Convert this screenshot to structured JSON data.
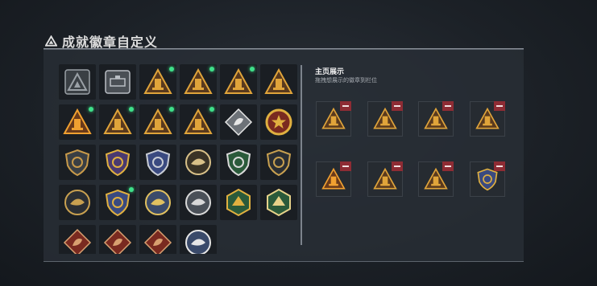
{
  "header": {
    "title": "成就徽章自定义",
    "icon": "triangle-logo-icon"
  },
  "collection": {
    "badges": [
      {
        "shape": "triangle-frame",
        "icon": "triangle-plain-badge-icon",
        "fill": "#3a3f44",
        "accent": "#9aa0a6",
        "new": false
      },
      {
        "shape": "shield-frame",
        "icon": "tank-badge-icon",
        "fill": "#4a4f55",
        "accent": "#b9bec4",
        "new": false
      },
      {
        "shape": "triangle",
        "icon": "triangle-skyscraper-badge-icon",
        "fill": "#5a3a1e",
        "accent": "#e0a43a",
        "new": true
      },
      {
        "shape": "triangle",
        "icon": "triangle-building-badge-icon",
        "fill": "#5a3a1e",
        "accent": "#e0a43a",
        "new": true
      },
      {
        "shape": "triangle",
        "icon": "triangle-tower-badge-icon",
        "fill": "#5a3a1e",
        "accent": "#e0a43a",
        "new": true
      },
      {
        "shape": "triangle",
        "icon": "triangle-warship-badge-icon",
        "fill": "#5a3a1e",
        "accent": "#e0a43a",
        "new": false
      },
      {
        "shape": "triangle",
        "icon": "triangle-number-one-badge-icon",
        "fill": "#6a3a1a",
        "accent": "#f0a030",
        "new": true
      },
      {
        "shape": "triangle",
        "icon": "triangle-house-badge-icon",
        "fill": "#5a3a1e",
        "accent": "#e0a43a",
        "new": true
      },
      {
        "shape": "triangle",
        "icon": "triangle-soldiers-badge-icon",
        "fill": "#5a3a1e",
        "accent": "#e0a43a",
        "new": true
      },
      {
        "shape": "triangle",
        "icon": "triangle-rocket-badge-icon",
        "fill": "#5a3a1e",
        "accent": "#e0a43a",
        "new": true
      },
      {
        "shape": "diamond",
        "icon": "silver-diamond-badge-icon",
        "fill": "#6d7278",
        "accent": "#e6e6e6",
        "new": false
      },
      {
        "shape": "round-medal",
        "icon": "star-wreath-medal-icon",
        "fill": "#7a2a20",
        "accent": "#e0b040",
        "new": false
      },
      {
        "shape": "shield",
        "icon": "rank-shield-badge-icon",
        "fill": "#3a3f44",
        "accent": "#c89a4a",
        "new": false
      },
      {
        "shape": "shield",
        "icon": "purple-eagle-shield-icon",
        "fill": "#4a3a70",
        "accent": "#e0b040",
        "new": false
      },
      {
        "shape": "shield",
        "icon": "blue-eagle-shield-icon",
        "fill": "#3a4a80",
        "accent": "#c8ccd4",
        "new": false
      },
      {
        "shape": "circle",
        "icon": "skull-target-badge-icon",
        "fill": "#3a3326",
        "accent": "#d8c088",
        "new": false
      },
      {
        "shape": "shield",
        "icon": "green-snake-shield-icon",
        "fill": "#2a5a3a",
        "accent": "#d8d8d8",
        "new": false
      },
      {
        "shape": "shield",
        "icon": "dark-rifle-shield-icon",
        "fill": "#2a2e33",
        "accent": "#c8a050",
        "new": false
      },
      {
        "shape": "circle",
        "icon": "crossed-circle-badge-icon",
        "fill": "#2a2e33",
        "accent": "#c8a050",
        "new": false
      },
      {
        "shape": "shield",
        "icon": "star-eagle-shield-icon",
        "fill": "#3a4a80",
        "accent": "#e0b040",
        "new": true
      },
      {
        "shape": "circle",
        "icon": "blue-bird-circle-icon",
        "fill": "#3a4a6a",
        "accent": "#e0c060",
        "new": false
      },
      {
        "shape": "circle",
        "icon": "steel-bird-circle-icon",
        "fill": "#4a5058",
        "accent": "#d8d8d8",
        "new": false
      },
      {
        "shape": "hexagon",
        "icon": "green-dragon-hex-icon",
        "fill": "#2a5a3a",
        "accent": "#e0b040",
        "new": false
      },
      {
        "shape": "hexagon",
        "icon": "green-eagle-hex-icon",
        "fill": "#2a5a3a",
        "accent": "#e6d28a",
        "new": false
      },
      {
        "shape": "diamond",
        "icon": "red-wolf-diamond-icon",
        "fill": "#7a2a20",
        "accent": "#d8a070",
        "new": false
      },
      {
        "shape": "diamond",
        "icon": "red-beast-diamond-icon",
        "fill": "#7a2a20",
        "accent": "#d8a070",
        "new": false
      },
      {
        "shape": "diamond",
        "icon": "red-soldier-diamond-icon",
        "fill": "#7a2a20",
        "accent": "#d8a070",
        "new": false
      },
      {
        "shape": "circle",
        "icon": "blue-ship-circle-icon",
        "fill": "#3a4a6a",
        "accent": "#e6e6e6",
        "new": false
      }
    ]
  },
  "showcase": {
    "title": "主页展示",
    "subtitle": "拖拽想展示的徽章到栏位",
    "slots": [
      {
        "icon": "triangle-skyscraper-badge-icon",
        "shape": "triangle",
        "fill": "#5a3a1e",
        "accent": "#e0a43a"
      },
      {
        "icon": "triangle-building-badge-icon",
        "shape": "triangle",
        "fill": "#5a3a1e",
        "accent": "#e0a43a"
      },
      {
        "icon": "triangle-tower-badge-icon",
        "shape": "triangle",
        "fill": "#5a3a1e",
        "accent": "#e0a43a"
      },
      {
        "icon": "triangle-soldiers-badge-icon",
        "shape": "triangle",
        "fill": "#5a3a1e",
        "accent": "#e0a43a"
      },
      {
        "icon": "triangle-number-one-badge-icon",
        "shape": "triangle",
        "fill": "#6a3a1a",
        "accent": "#f0a030"
      },
      {
        "icon": "triangle-rocket-badge-icon",
        "shape": "triangle",
        "fill": "#5a3a1e",
        "accent": "#e0a43a"
      },
      {
        "icon": "triangle-house-badge-icon",
        "shape": "triangle",
        "fill": "#5a3a1e",
        "accent": "#e0a43a"
      },
      {
        "icon": "star-eagle-shield-icon",
        "shape": "shield",
        "fill": "#3a4a80",
        "accent": "#e0b040"
      }
    ],
    "remove_icon": "remove-minus-icon",
    "remove_color": "#8e2c34"
  },
  "colors": {
    "new_indicator": "#3fe08a",
    "panel_bg": "#282e36"
  }
}
